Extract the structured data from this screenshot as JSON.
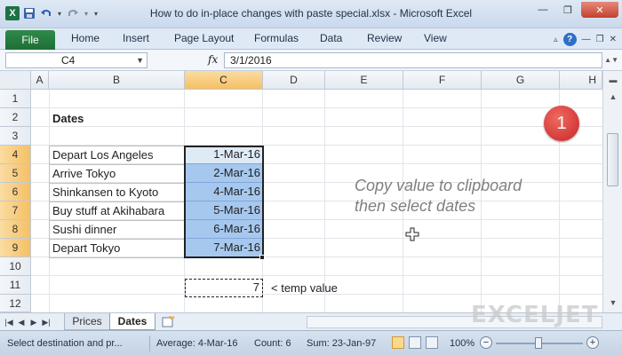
{
  "window": {
    "title": "How to do in-place changes with paste special.xlsx - Microsoft Excel"
  },
  "ribbon": {
    "tabs": [
      "File",
      "Home",
      "Insert",
      "Page Layout",
      "Formulas",
      "Data",
      "Review",
      "View"
    ]
  },
  "formula_bar": {
    "name_box": "C4",
    "fx": "fx",
    "value": "3/1/2016"
  },
  "columns": [
    "A",
    "B",
    "C",
    "D",
    "E",
    "F",
    "G",
    "H"
  ],
  "rows": [
    "1",
    "2",
    "3",
    "4",
    "5",
    "6",
    "7",
    "8",
    "9",
    "10",
    "11",
    "12"
  ],
  "sheet": {
    "heading": "Dates",
    "events": [
      {
        "name": "Depart Los Angeles",
        "date": "1-Mar-16"
      },
      {
        "name": "Arrive Tokyo",
        "date": "2-Mar-16"
      },
      {
        "name": "Shinkansen to Kyoto",
        "date": "4-Mar-16"
      },
      {
        "name": "Buy stuff at Akihabara",
        "date": "5-Mar-16"
      },
      {
        "name": "Sushi dinner",
        "date": "6-Mar-16"
      },
      {
        "name": "Depart Tokyo",
        "date": "7-Mar-16"
      }
    ],
    "temp_value": "7",
    "temp_label": "< temp value",
    "note_line1": "Copy value to clipboard",
    "note_line2": "then select dates",
    "step_badge": "1"
  },
  "sheet_tabs": [
    "Prices",
    "Dates"
  ],
  "active_sheet": "Dates",
  "watermark": "EXCELJET",
  "status_bar": {
    "message": "Select destination and pr...",
    "average": "Average: 4-Mar-16",
    "count": "Count: 6",
    "sum": "Sum: 23-Jan-97",
    "zoom": "100%"
  },
  "colors": {
    "selection_fill": "#a6c8ee",
    "active_cell_fill": "#dfeaf7",
    "header_highlight": "#f5c064",
    "file_tab": "#1e7145",
    "badge": "#c8262b",
    "note_text": "#7f7f7f"
  }
}
